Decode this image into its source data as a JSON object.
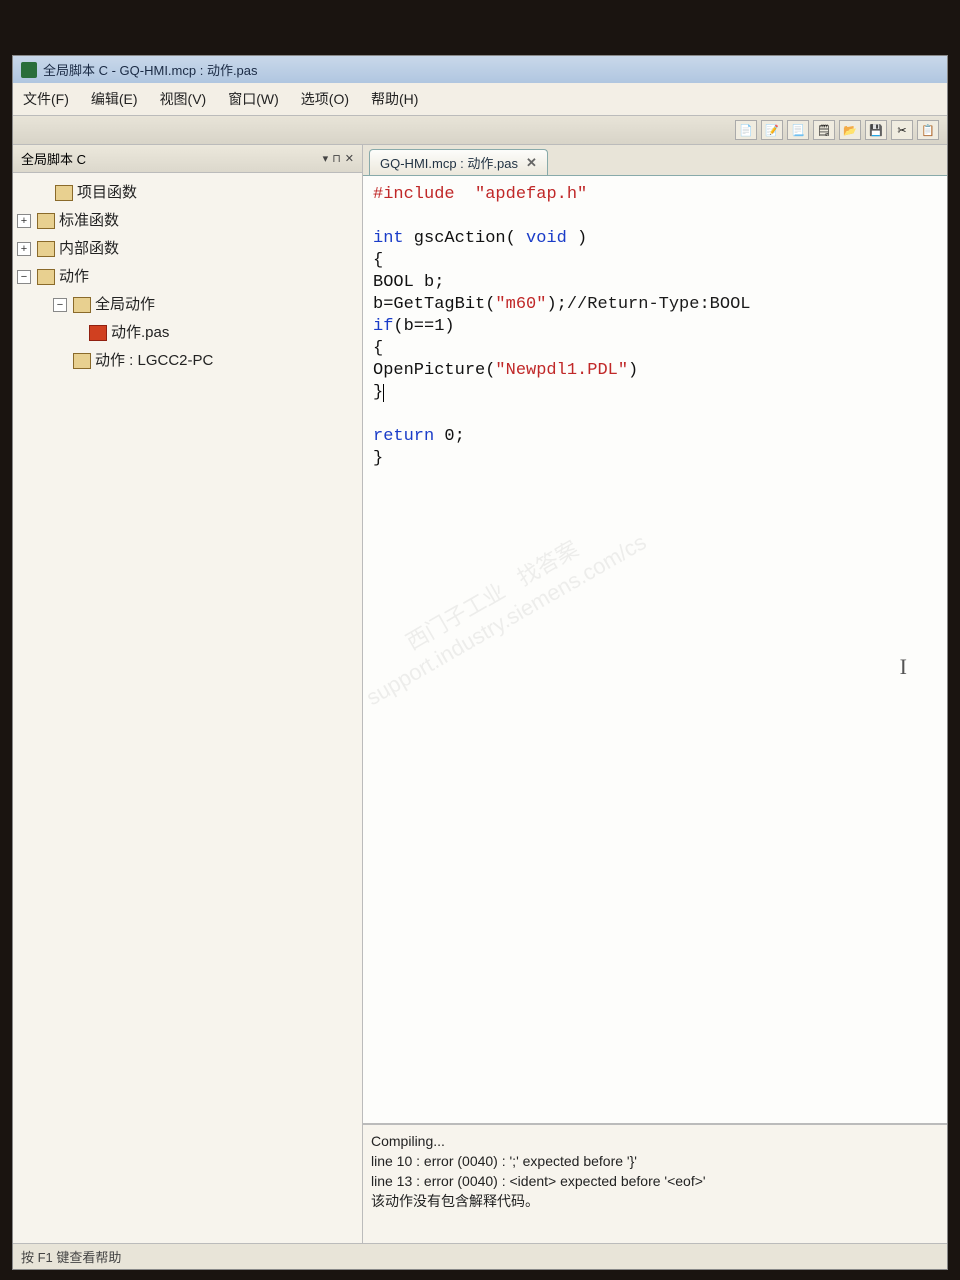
{
  "window": {
    "title": "全局脚本 C - GQ-HMI.mcp : 动作.pas"
  },
  "menu": {
    "file": "文件(F)",
    "edit": "编辑(E)",
    "view": "视图(V)",
    "window": "窗口(W)",
    "options": "选项(O)",
    "help": "帮助(H)"
  },
  "sidebar": {
    "title": "全局脚本 C",
    "pin_dropdown": "▾",
    "pin_btn": "⏷",
    "close_btn": "✕",
    "items": {
      "project_fn": "项目函数",
      "standard_fn": "标准函数",
      "internal_fn": "内部函数",
      "actions": "动作",
      "global_actions": "全局动作",
      "action_pas": "动作.pas",
      "action_pc": "动作 : LGCC2-PC"
    }
  },
  "tab": {
    "label": "GQ-HMI.mcp : 动作.pas",
    "close": "✕"
  },
  "code": {
    "l1a": "#include",
    "l1b": "\"apdefap.h\"",
    "l3a": "int",
    "l3b": " gscAction( ",
    "l3c": "void",
    "l3d": " )",
    "l4": "{",
    "l5": "BOOL b;",
    "l6a": "b=GetTagBit(",
    "l6b": "\"m60\"",
    "l6c": ");",
    "l6d": "//Return-Type:BOOL",
    "l7a": "if",
    "l7b": "(b==1)",
    "l8": "{",
    "l9a": "OpenPicture(",
    "l9b": "\"Newpdl1.PDL\"",
    "l9c": ")",
    "l10": "}",
    "l12a": "return",
    "l12b": " 0;",
    "l13": "}"
  },
  "output": {
    "l1": "Compiling...",
    "l2": "line  10 : error (0040) : ';' expected before '}'",
    "l3": "line  13 : error (0040) : <ident> expected before '<eof>'",
    "l4": "该动作没有包含解释代码。"
  },
  "statusbar": {
    "text": "按 F1 键查看帮助"
  },
  "watermark": "西门子工业   找答案\nsupport.industry.siemens.com/cs"
}
